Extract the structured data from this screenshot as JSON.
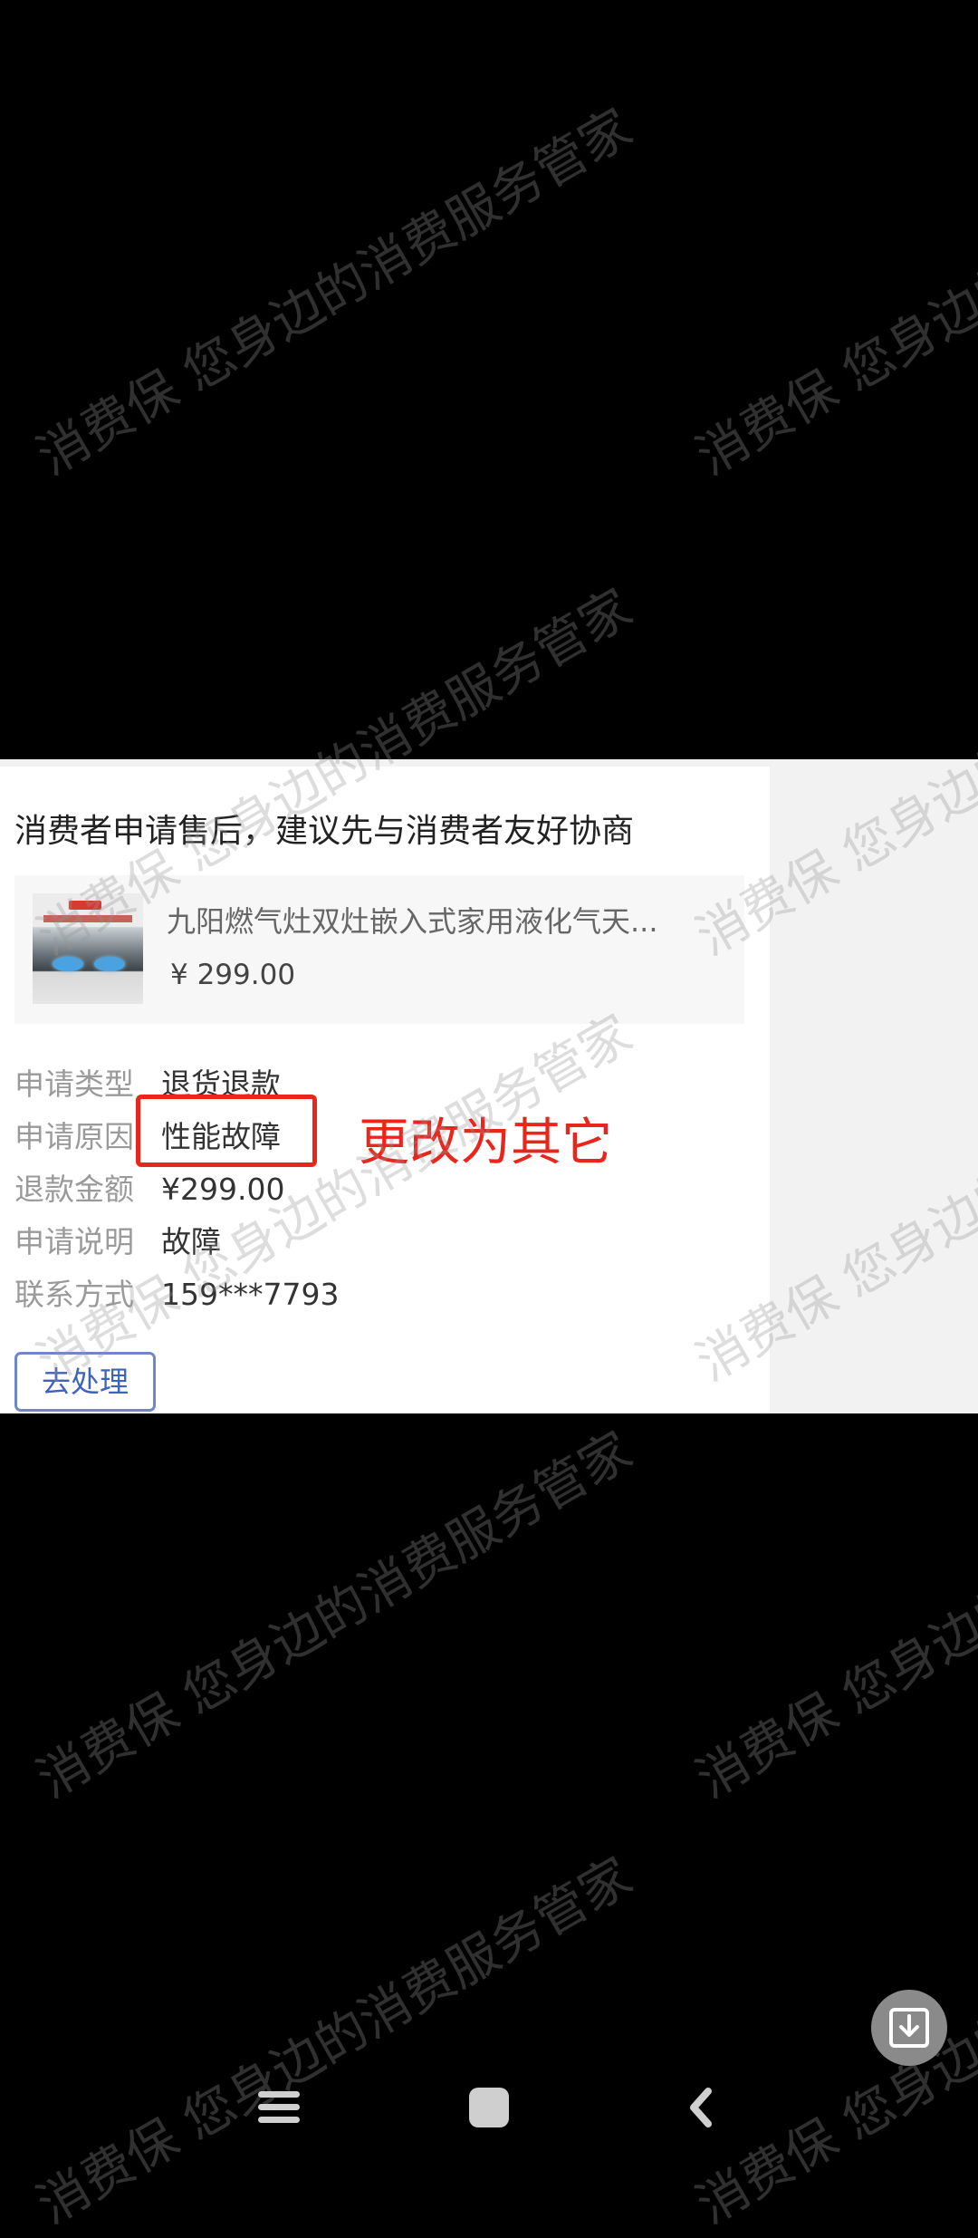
{
  "watermark": {
    "text": "消费保 您身边的消费服务管家"
  },
  "notice": {
    "headline": "消费者申请售后，建议先与消费者友好协商"
  },
  "product": {
    "title": "九阳燃气灶双灶嵌入式家用液化气天...",
    "price": "¥ 299.00",
    "thumbnail_icon": "gas-stove-image"
  },
  "details": [
    {
      "label": "申请类型",
      "value": "退货退款"
    },
    {
      "label": "申请原因",
      "value": "性能故障"
    },
    {
      "label": "退款金额",
      "value": "¥299.00"
    },
    {
      "label": "申请说明",
      "value": "故障"
    },
    {
      "label": "联系方式",
      "value": "159***7793"
    }
  ],
  "annotation": {
    "text": "更改为其它",
    "color": "#e8261c"
  },
  "actions": {
    "process_label": "去处理"
  },
  "floating": {
    "download_icon": "download-icon"
  },
  "nav": {
    "menu_icon": "menu-icon",
    "home_icon": "home-icon",
    "back_icon": "back-icon"
  },
  "colors": {
    "accent": "#3f62bd",
    "highlight": "#e8261c",
    "background": "#000000"
  }
}
